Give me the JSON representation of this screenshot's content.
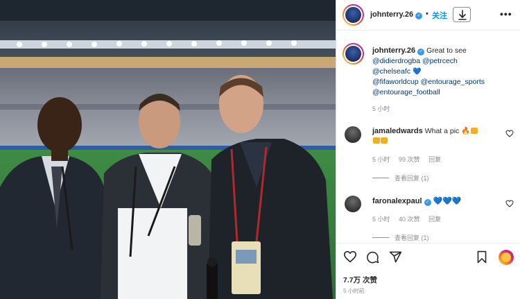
{
  "post": {
    "username": "johnterry.26",
    "follow_label": "关注",
    "separator": "•",
    "more_label": "•••",
    "caption_lines": [
      "Great to see",
      "@didierdrogba @petrcech",
      "@chelseafc",
      "@fifaworldcup @entourage_sports",
      "@entourage_football"
    ],
    "caption_time": "5 小时",
    "likes": "7.7万 次赞",
    "posted_time": "5 小时前"
  },
  "comments": [
    {
      "username": "jamaledwards",
      "text": "What a pic",
      "time": "5 小时",
      "likes": "99 次赞",
      "reply_label": "回复",
      "view_replies": "查看回复 (1)"
    },
    {
      "username": "faronalexpaul",
      "text": "",
      "time": "5 小时",
      "likes": "40 次赞",
      "reply_label": "回复",
      "view_replies": "查看回复 (1)"
    }
  ],
  "icons": {
    "verified": "verified-badge-icon",
    "download": "download-icon",
    "more": "more-options-icon",
    "like": "heart-icon",
    "comment": "comment-icon",
    "share": "share-icon",
    "save": "bookmark-icon",
    "emoji_heart": "blue-heart-icon"
  },
  "colors": {
    "link": "#00376b",
    "follow": "#0095f6",
    "verified": "#3897f0",
    "muted": "#8e8e8e"
  }
}
